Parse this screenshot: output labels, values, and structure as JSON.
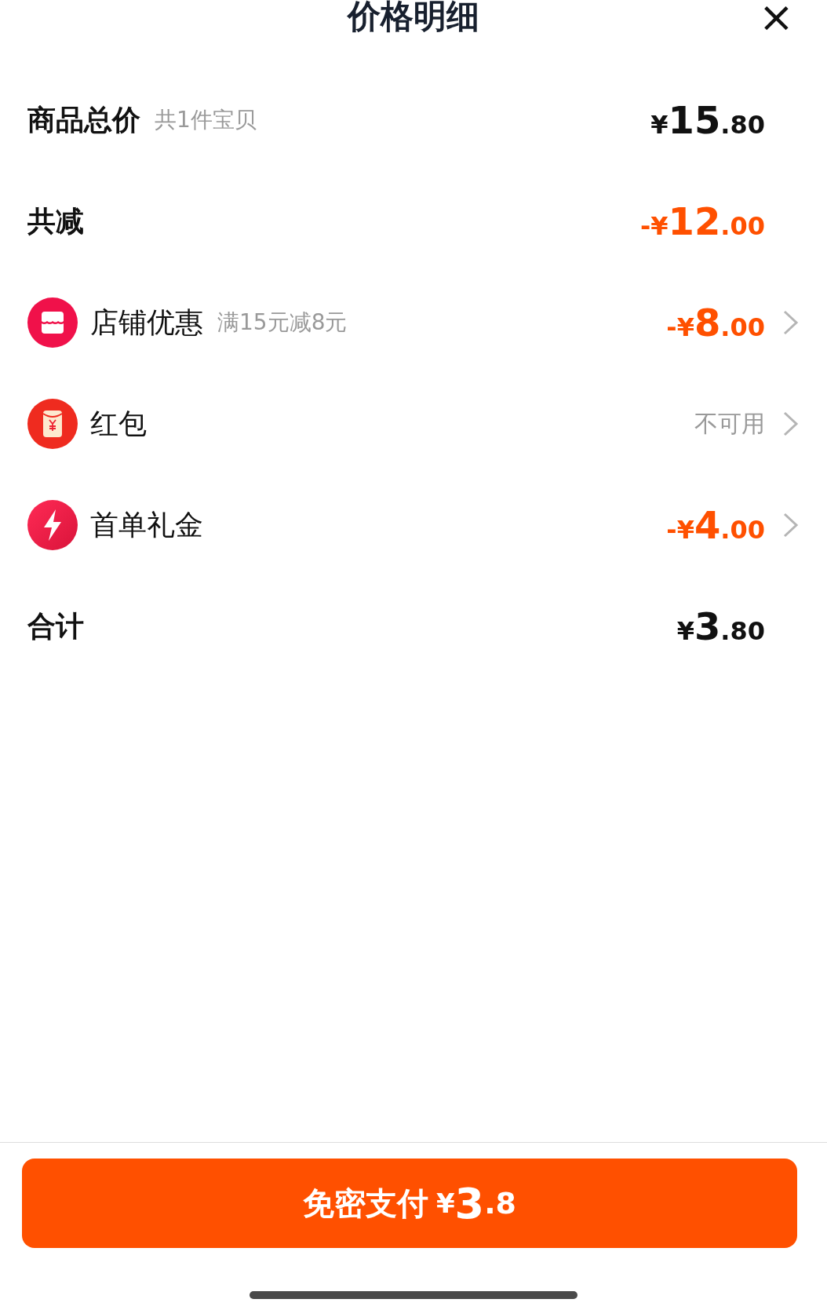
{
  "header": {
    "title": "价格明细",
    "close": "×"
  },
  "rows": [
    {
      "kind": "summary",
      "label": "商品总价",
      "note": "共1件宝贝",
      "amount": {
        "color": "#111111",
        "prefix": "¥",
        "whole": "15",
        "fraction": ".80"
      }
    },
    {
      "kind": "summary",
      "label": "共减",
      "amount": {
        "color": "#ff5000",
        "prefix": "-¥",
        "whole": "12",
        "fraction": ".00"
      }
    },
    {
      "kind": "item",
      "label": "店铺优惠",
      "note": "满15元减8元",
      "amount": {
        "color": "#ff5000",
        "prefix": "-¥",
        "whole": "8",
        "fraction": ".00"
      }
    },
    {
      "kind": "item",
      "label": "红包",
      "status": "不可用"
    },
    {
      "kind": "item",
      "label": "首单礼金",
      "amount": {
        "color": "#ff5000",
        "prefix": "-¥",
        "whole": "4",
        "fraction": ".00"
      }
    },
    {
      "kind": "summary",
      "label": "合计",
      "amount": {
        "color": "#111111",
        "prefix": "¥",
        "whole": "3",
        "fraction": ".80"
      }
    }
  ],
  "pay_button": {
    "label": "免密支付",
    "prefix": "¥",
    "whole": "3",
    "fraction": ".8"
  }
}
